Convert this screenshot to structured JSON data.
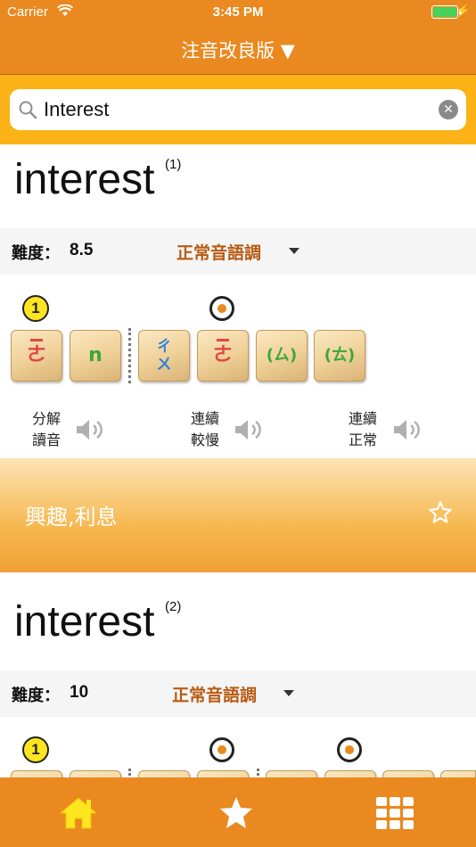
{
  "status": {
    "carrier": "Carrier",
    "time": "3:45 PM"
  },
  "nav": {
    "title": "注音改良版 ▼"
  },
  "search": {
    "value": "Interest",
    "placeholder": ""
  },
  "labels": {
    "split_read": [
      "分解",
      "讀音"
    ],
    "cont_slow": [
      "連續",
      "較慢"
    ],
    "cont_normal": [
      "連續",
      "正常"
    ]
  },
  "entries": [
    {
      "word": "interest",
      "index": "(1)",
      "difficulty_label": "難度：",
      "difficulty_value": "8.5",
      "tone_mode": "正常音語調",
      "syllable_badge": "1",
      "tiles": [
        "ㄜ",
        "n",
        "ㄔㄨ",
        "ㄜ",
        "(ㄙ)",
        "(ㄊ)"
      ],
      "meaning": "興趣,利息"
    },
    {
      "word": "interest",
      "index": "(2)",
      "difficulty_label": "難度：",
      "difficulty_value": "10",
      "tone_mode": "正常音語調",
      "syllable_badge": "1"
    }
  ],
  "tabs": [
    "home",
    "favorites",
    "grid"
  ],
  "colors": {
    "brand": "#e9891f",
    "search_bg": "#fbb317",
    "tone_text": "#b85a12"
  }
}
